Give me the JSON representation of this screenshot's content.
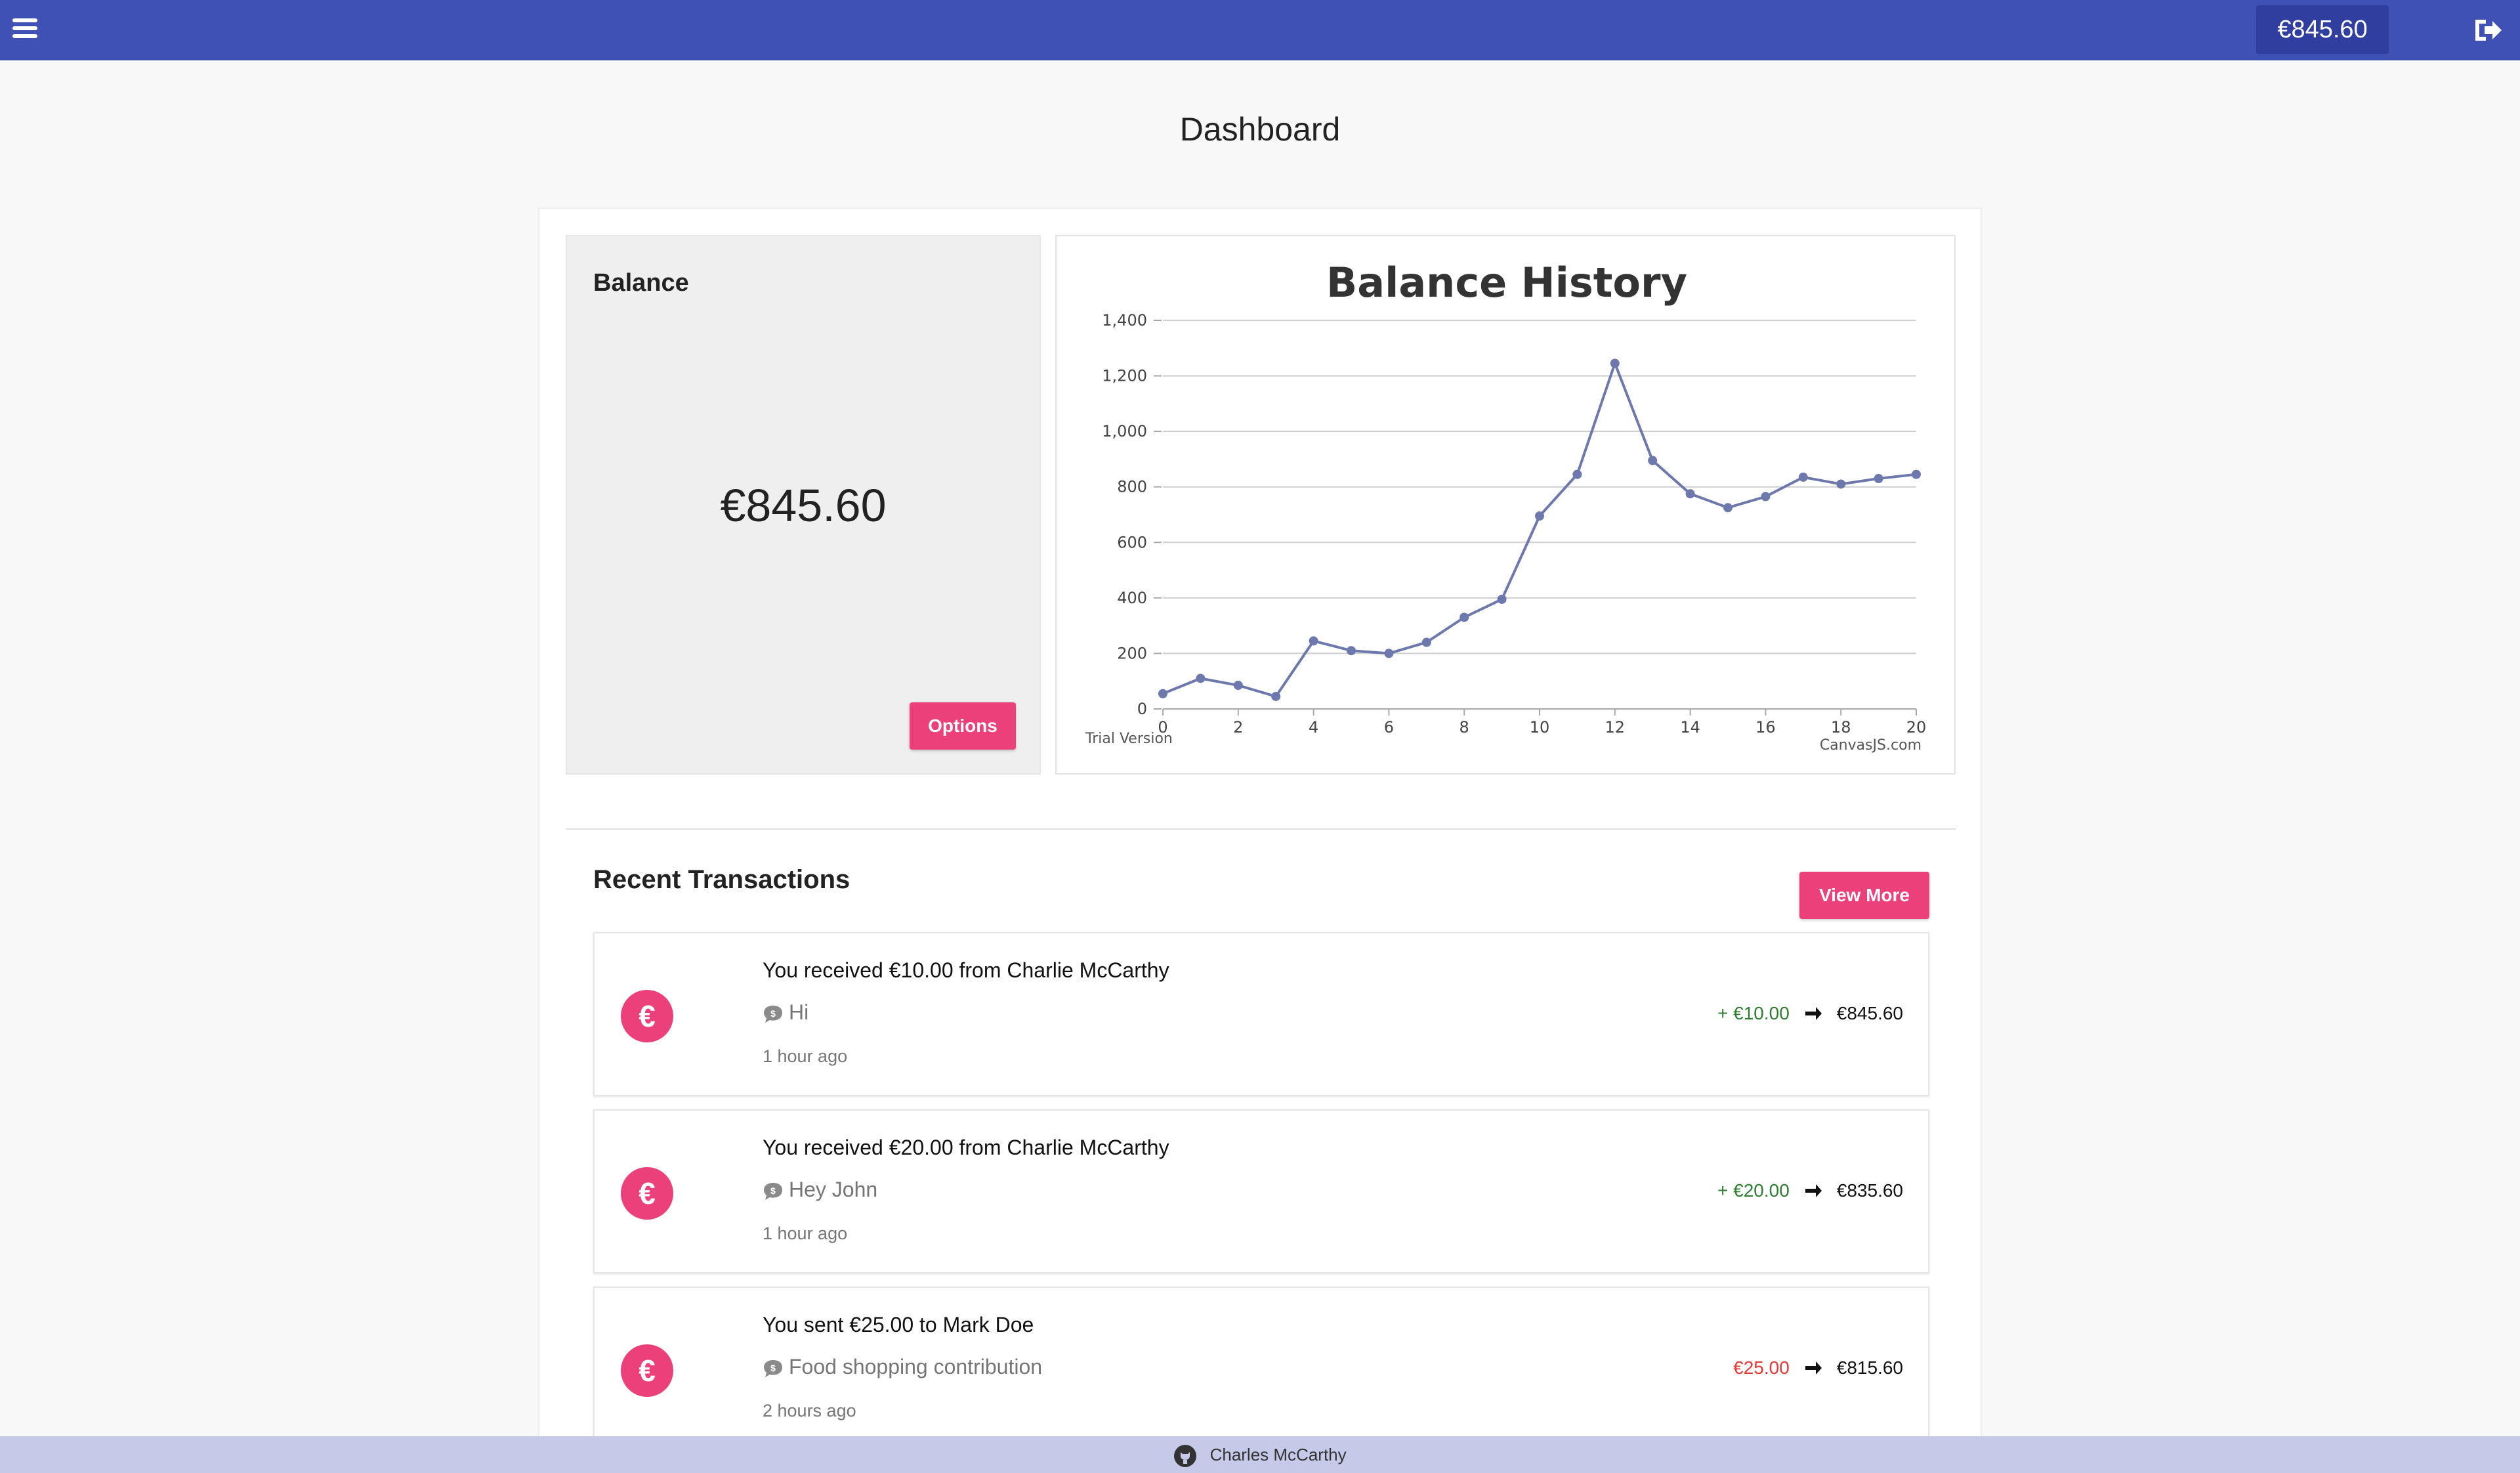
{
  "topbar": {
    "balance": "€845.60",
    "menu_icon": "hamburger-menu-icon",
    "logout_icon": "sign-out-icon"
  },
  "page": {
    "title": "Dashboard"
  },
  "balance_panel": {
    "label": "Balance",
    "amount": "€845.60",
    "options_label": "Options"
  },
  "chart_data": {
    "type": "line",
    "title": "Balance History",
    "xlabel": "",
    "ylabel": "",
    "x": [
      0,
      1,
      2,
      3,
      4,
      5,
      6,
      7,
      8,
      9,
      10,
      11,
      12,
      13,
      14,
      15,
      16,
      17,
      18,
      19,
      20
    ],
    "series": [
      {
        "values": [
          55,
          110,
          85,
          45,
          245,
          210,
          200,
          240,
          330,
          395,
          695,
          845,
          1245,
          895,
          775,
          725,
          765,
          835,
          810,
          830,
          845
        ]
      }
    ],
    "xlim": [
      0,
      20
    ],
    "ylim": [
      0,
      1400
    ],
    "xticks": [
      "0",
      "2",
      "4",
      "6",
      "8",
      "10",
      "12",
      "14",
      "16",
      "18",
      "20"
    ],
    "yticks": [
      "0",
      "200",
      "400",
      "600",
      "800",
      "1,000",
      "1,200",
      "1,400"
    ],
    "grid": true,
    "color": "#6d78ad",
    "watermark_left": "Trial Version",
    "watermark_right": "CanvasJS.com"
  },
  "recent": {
    "title": "Recent Transactions",
    "view_more_label": "View More",
    "transactions": [
      {
        "icon": "€",
        "title": "You received €10.00 from Charlie McCarthy",
        "message": "Hi",
        "time": "1 hour ago",
        "delta": "+ €10.00",
        "new_balance": "€845.60"
      },
      {
        "icon": "€",
        "title": "You received €20.00 from Charlie McCarthy",
        "message": "Hey John",
        "time": "1 hour ago",
        "delta": "+ €20.00",
        "new_balance": "€835.60"
      },
      {
        "icon": "€",
        "title": "You sent €25.00 to Mark Doe",
        "message": "Food shopping contribution",
        "time": "2 hours ago",
        "delta": "€25.00",
        "new_balance": "€815.60"
      }
    ]
  },
  "footer": {
    "author": "Charles McCarthy"
  },
  "colors": {
    "primary": "#3f51b5",
    "primary_dark": "#303f9f",
    "accent": "#ec407a",
    "positive": "#2e7d32",
    "negative": "#e53935"
  }
}
